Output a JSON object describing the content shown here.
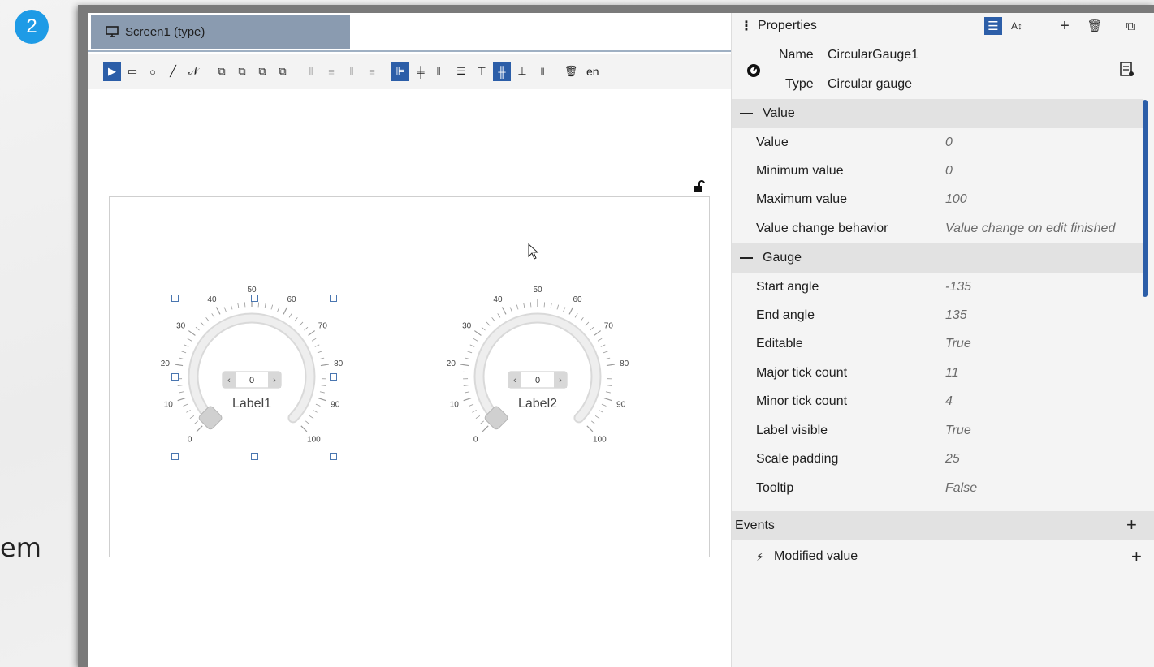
{
  "step_badge": "2",
  "background_text": "em",
  "editor": {
    "tab_label": "Screen1 (type)",
    "toolbar_language": "en"
  },
  "gauges": [
    {
      "label": "Label1",
      "value": "0",
      "scale_labels": [
        "0",
        "10",
        "20",
        "30",
        "40",
        "50",
        "60",
        "70",
        "80",
        "90",
        "100"
      ],
      "selected": true
    },
    {
      "label": "Label2",
      "value": "0",
      "scale_labels": [
        "0",
        "10",
        "20",
        "30",
        "40",
        "50",
        "60",
        "70",
        "80",
        "90",
        "100"
      ],
      "selected": false
    }
  ],
  "properties": {
    "title": "Properties",
    "name_label": "Name",
    "name_value": "CircularGauge1",
    "type_label": "Type",
    "type_value": "Circular gauge",
    "sections": [
      {
        "title": "Value",
        "rows": [
          {
            "label": "Value",
            "value": "0"
          },
          {
            "label": "Minimum value",
            "value": "0"
          },
          {
            "label": "Maximum value",
            "value": "100"
          },
          {
            "label": "Value change behavior",
            "value": "Value change on edit finished"
          }
        ]
      },
      {
        "title": "Gauge",
        "rows": [
          {
            "label": "Start angle",
            "value": "-135"
          },
          {
            "label": "End angle",
            "value": "135"
          },
          {
            "label": "Editable",
            "value": "True"
          },
          {
            "label": "Major tick count",
            "value": "11"
          },
          {
            "label": "Minor tick count",
            "value": "4"
          },
          {
            "label": "Label visible",
            "value": "True"
          },
          {
            "label": "Scale padding",
            "value": "25"
          },
          {
            "label": "Tooltip",
            "value": "False"
          }
        ]
      }
    ],
    "events_title": "Events",
    "events": [
      {
        "label": "Modified value"
      }
    ]
  },
  "colors": {
    "accent": "#2c5ea8",
    "badge": "#1e9be6",
    "tab": "#8a9bb0",
    "section_bg": "#e2e2e2"
  }
}
